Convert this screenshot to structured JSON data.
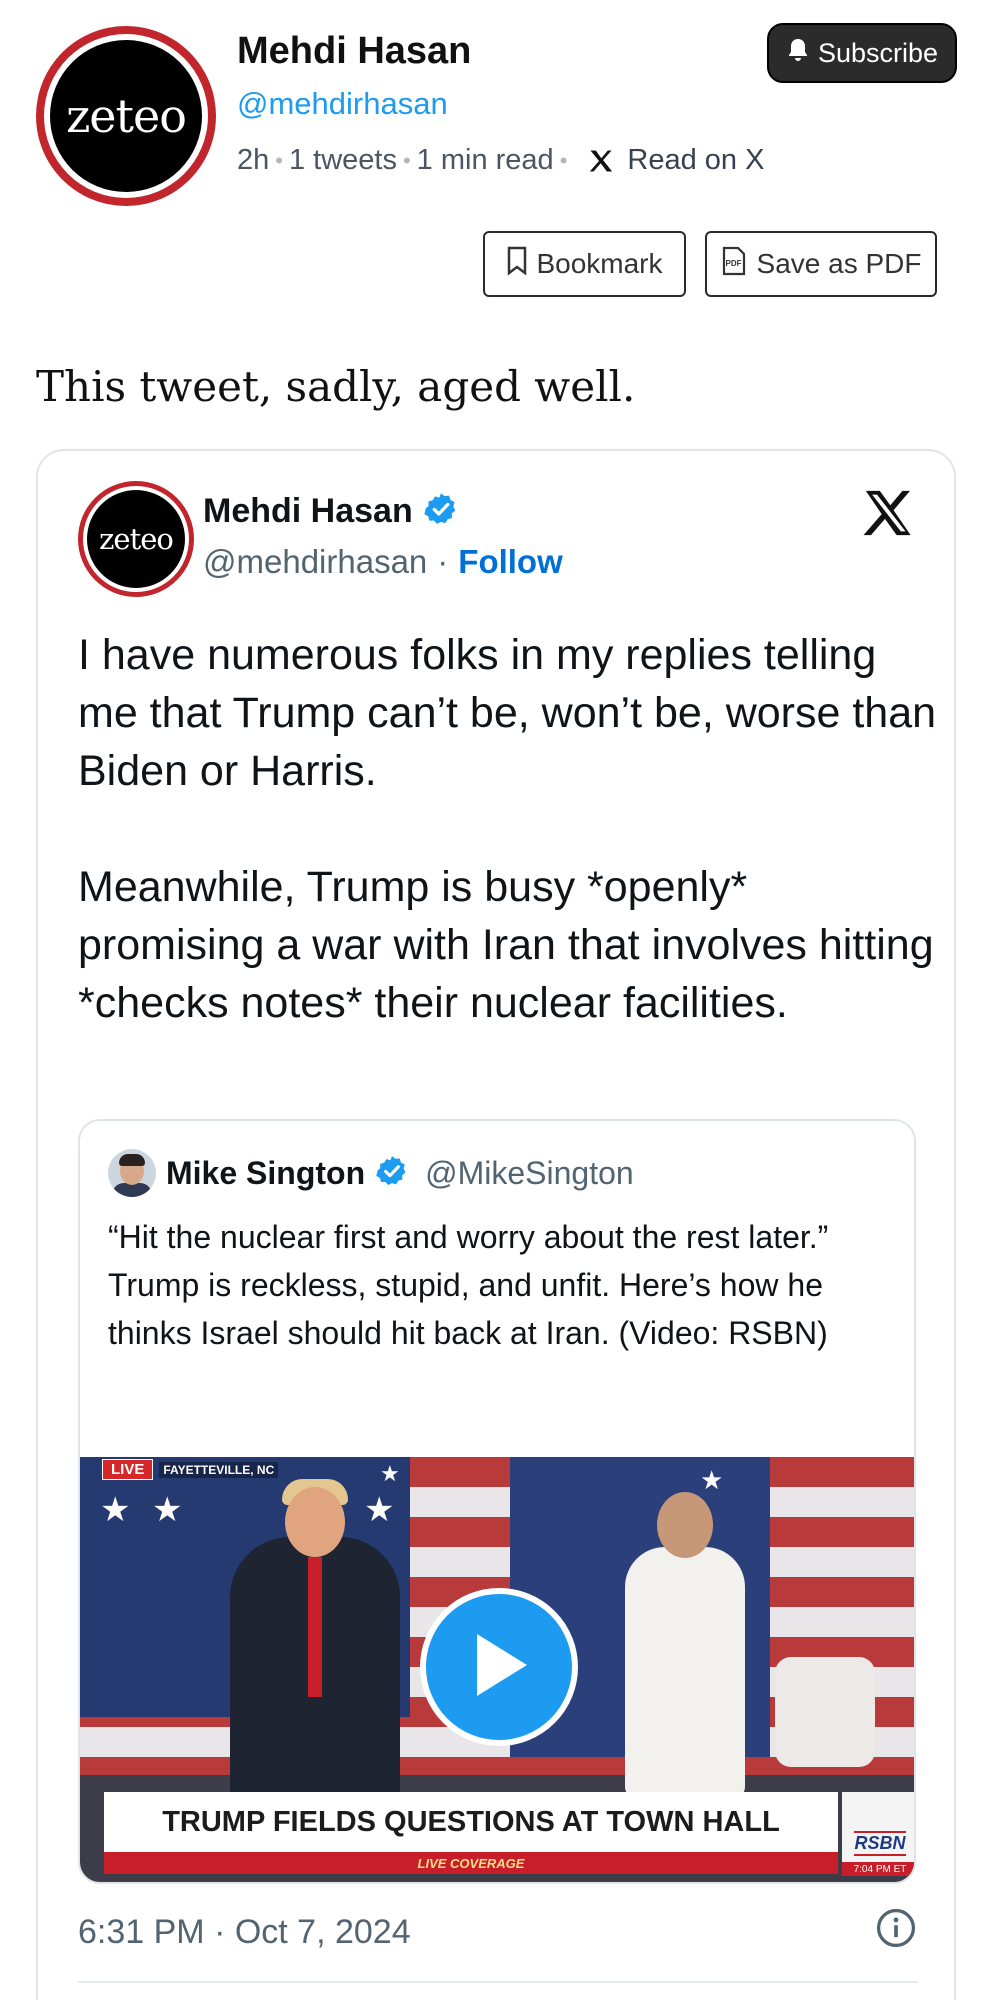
{
  "header": {
    "publication_logo_text": "zeteo",
    "author_name": "Mehdi Hasan",
    "author_handle": "@mehdirhasan",
    "meta": {
      "age": "2h",
      "tweet_count": "1 tweets",
      "read_time": "1 min read",
      "read_on": "Read on X"
    },
    "subscribe_label": "Subscribe",
    "bookmark_label": "Bookmark",
    "save_pdf_label": "Save as PDF",
    "pdf_icon_text": "PDF"
  },
  "lead_text": "This tweet, sadly, aged well.",
  "tweet": {
    "avatar_logo_text": "zeteo",
    "name": "Mehdi Hasan",
    "verified": true,
    "handle": "@mehdirhasan",
    "separator": "·",
    "follow_label": "Follow",
    "paragraphs": [
      "I have numerous folks in my replies telling me that Trump can’t be, won’t be, worse than Biden or Harris.",
      "Meanwhile, Trump is busy *openly* promising a war with Iran that involves hitting *checks notes* their nuclear facilities."
    ],
    "timestamp": "6:31 PM · Oct 7, 2024",
    "quote": {
      "name": "Mike Sington",
      "verified": true,
      "handle": "@MikeSington",
      "text": "“Hit the nuclear first and worry about the rest later.” Trump is reckless, stupid, and unfit. Here’s how he thinks Israel should hit back at Iran. (Video: RSBN)",
      "video": {
        "live_label": "LIVE",
        "location": "FAYETTEVILLE, NC",
        "headline": "TRUMP FIELDS QUESTIONS AT TOWN HALL",
        "ticker": "LIVE COVERAGE",
        "network": "RSBN",
        "clock": "7:04 PM ET"
      }
    }
  },
  "colors": {
    "link_blue": "#1d9bf0",
    "follow_blue": "#006fd6",
    "zeteo_red": "#c0262c",
    "play_blue": "#1d9bf0"
  }
}
